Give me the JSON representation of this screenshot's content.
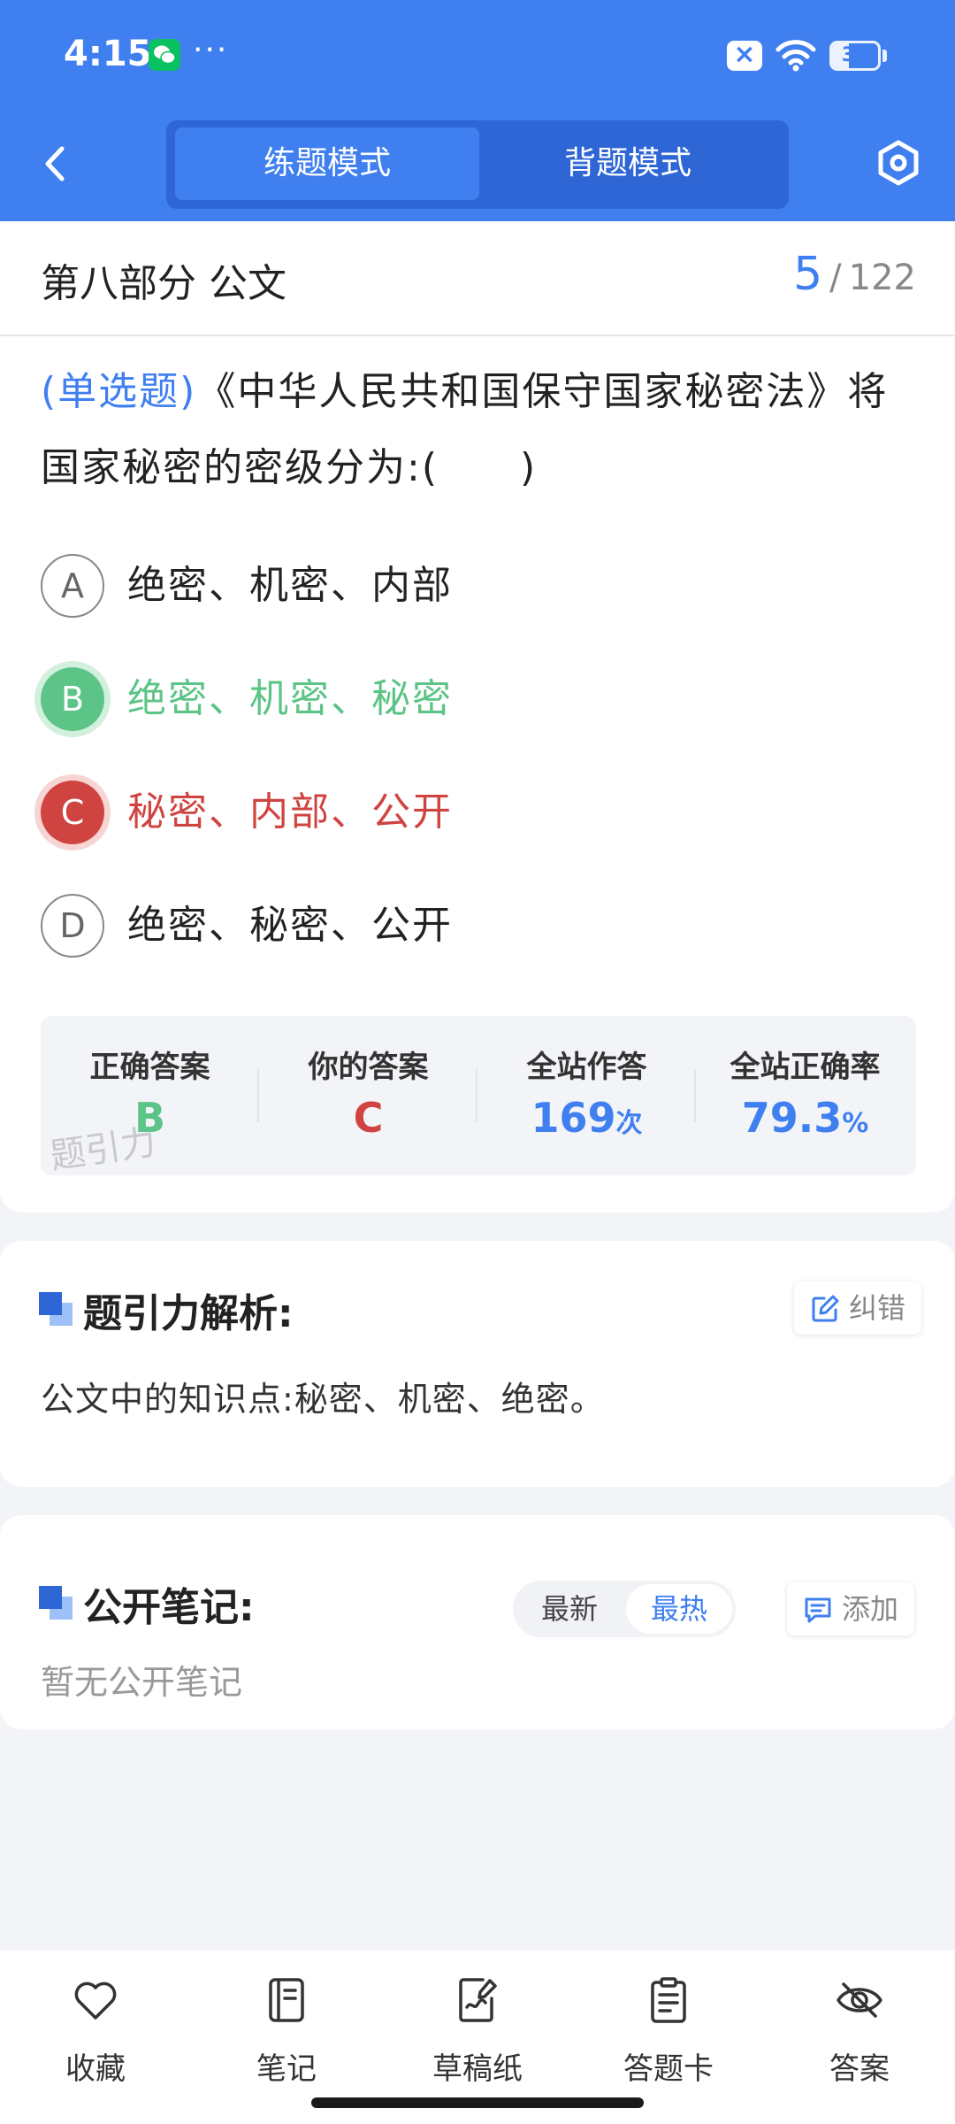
{
  "status_bar": {
    "time": "4:15",
    "dots": "···",
    "battery": "37",
    "battery_level": 0.37
  },
  "header": {
    "mode_tabs": [
      "练题模式",
      "背题模式"
    ],
    "active_mode": "练题模式"
  },
  "question": {
    "section": "第八部分 公文",
    "progress_current": "5",
    "progress_sep": "/",
    "progress_total": "122",
    "type": "(单选题)",
    "text": "《中华人民共和国保守国家秘密法》将国家秘密的密级分为:(　　)",
    "options": [
      {
        "letter": "A",
        "text": "绝密、机密、内部",
        "state": "normal"
      },
      {
        "letter": "B",
        "text": "绝密、机密、秘密",
        "state": "correct"
      },
      {
        "letter": "C",
        "text": "秘密、内部、公开",
        "state": "wrong"
      },
      {
        "letter": "D",
        "text": "绝密、秘密、公开",
        "state": "normal"
      }
    ]
  },
  "stats": {
    "correct_label": "正确答案",
    "correct_value": "B",
    "yours_label": "你的答案",
    "yours_value": "C",
    "attempts_label": "全站作答",
    "attempts_value": "169",
    "attempts_unit": "次",
    "rate_label": "全站正确率",
    "rate_value": "79.3",
    "rate_unit": "%",
    "watermark": "题引力"
  },
  "analysis": {
    "title": "题引力解析:",
    "report_button": "纠错",
    "text": "公文中的知识点:秘密、机密、绝密。"
  },
  "notes": {
    "title": "公开笔记:",
    "sort_latest": "最新",
    "sort_hot": "最热",
    "add_button": "添加",
    "empty_text": "暂无公开笔记"
  },
  "bottom_nav": [
    {
      "label": "收藏",
      "icon": "heart-icon"
    },
    {
      "label": "笔记",
      "icon": "notebook-icon"
    },
    {
      "label": "草稿纸",
      "icon": "draft-icon"
    },
    {
      "label": "答题卡",
      "icon": "answer-card-icon"
    },
    {
      "label": "答案",
      "icon": "eye-off-icon"
    }
  ],
  "colors": {
    "primary": "#3f7ff0",
    "correct": "#5cc486",
    "wrong": "#cf4440"
  }
}
